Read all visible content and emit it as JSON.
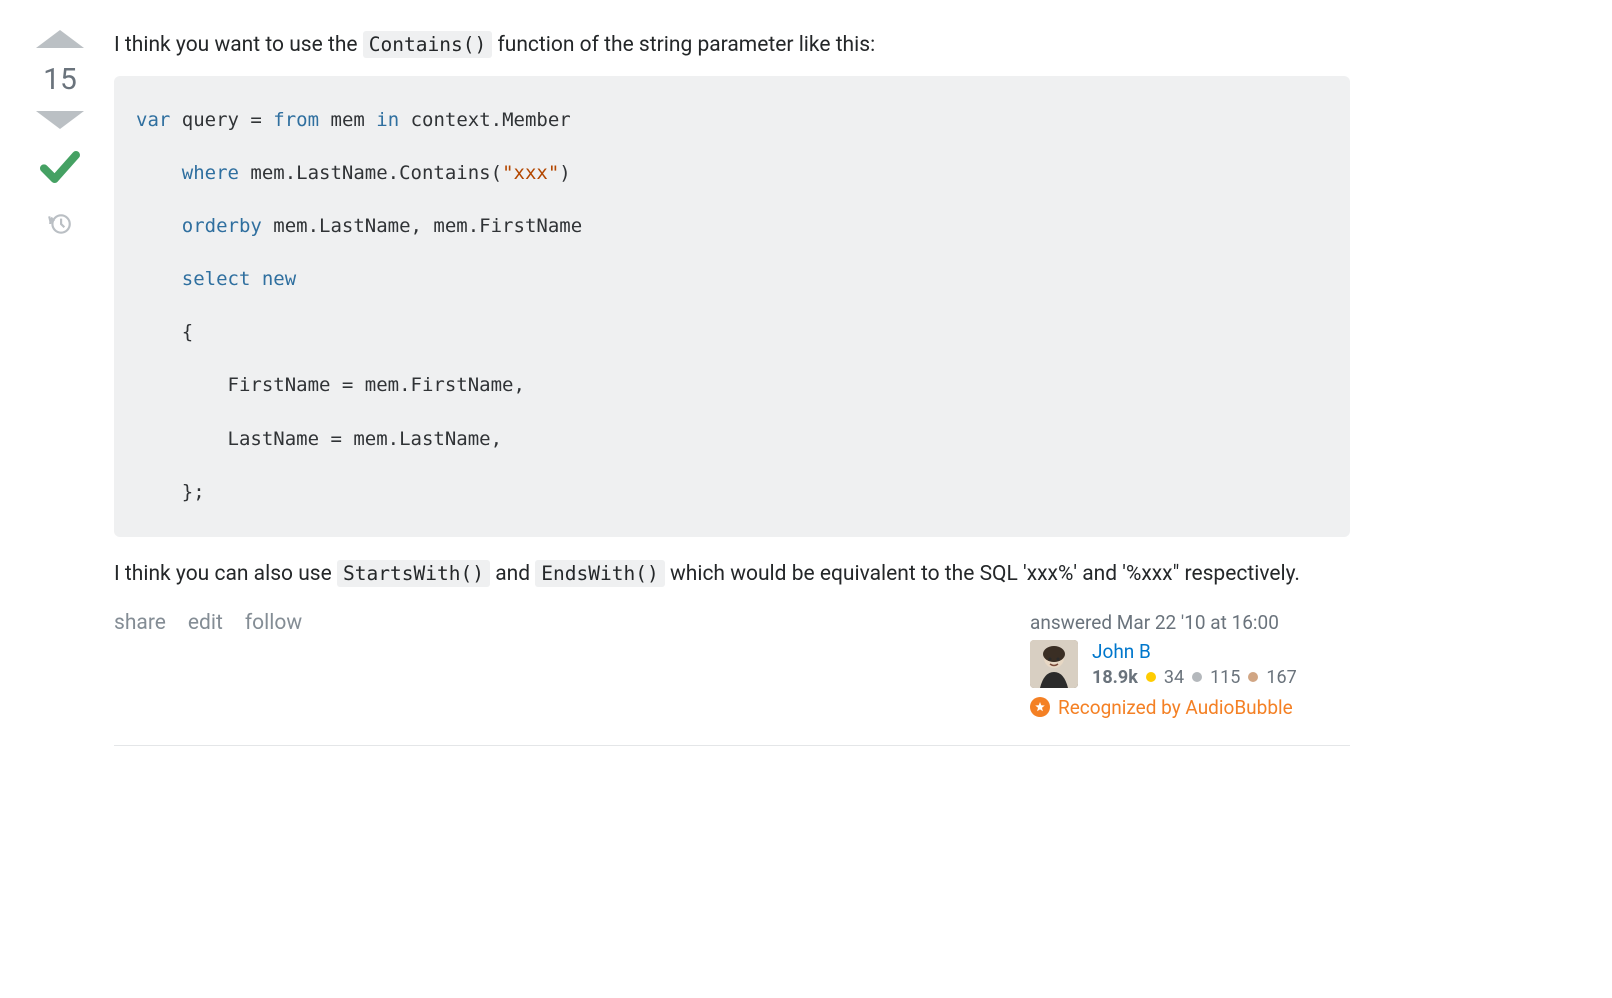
{
  "vote": {
    "score": "15"
  },
  "prose": {
    "p1_a": "I think you want to use the ",
    "p1_code": "Contains()",
    "p1_b": " function of the string parameter like this:",
    "p2_a": "I think you can also use ",
    "p2_code1": "StartsWith()",
    "p2_mid": " and ",
    "p2_code2": "EndsWith()",
    "p2_b": " which would be equivalent to the SQL 'xxx%' and '%xxx\" respectively."
  },
  "code": {
    "l1_kw1": "var",
    "l1_t1": " query ",
    "l1_op": "=",
    "l1_kw2": " from",
    "l1_t2": " mem ",
    "l1_kw3": "in",
    "l1_t3": " context.Member",
    "l2_kw": "    where",
    "l2_t": " mem.LastName.Contains(",
    "l2_str": "\"xxx\"",
    "l2_t2": ")",
    "l3_kw": "    orderby",
    "l3_t": " mem.LastName, mem.FirstName",
    "l4_kw": "    select",
    "l4_kw2": " new",
    "l5": "    {",
    "l6": "        FirstName = mem.FirstName,",
    "l7": "        LastName = mem.LastName,",
    "l8": "    };"
  },
  "actions": {
    "share": "share",
    "edit": "edit",
    "follow": "follow"
  },
  "usercard": {
    "answered_label": "answered ",
    "answered_time": "Mar 22 '10 at 16:00",
    "username": "John B",
    "reputation": "18.9k",
    "gold": "34",
    "silver": "115",
    "bronze": "167",
    "recognized": "Recognized by AudioBubble"
  }
}
